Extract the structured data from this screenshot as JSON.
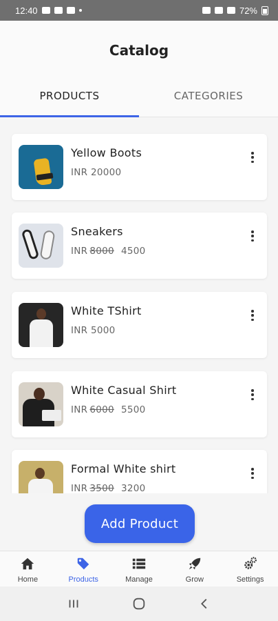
{
  "status_bar": {
    "time": "12:40",
    "battery": "72%"
  },
  "header": {
    "title": "Catalog"
  },
  "tabs": [
    {
      "label": "PRODUCTS",
      "active": true
    },
    {
      "label": "CATEGORIES",
      "active": false
    }
  ],
  "products": [
    {
      "name": "Yellow Boots",
      "currency": "INR",
      "price": "20000",
      "old_price": "",
      "image": "yellow-boots-photo"
    },
    {
      "name": "Sneakers",
      "currency": "INR",
      "price": "4500",
      "old_price": "8000",
      "image": "sneakers-photo"
    },
    {
      "name": "White TShirt",
      "currency": "INR",
      "price": "5000",
      "old_price": "",
      "image": "white-tshirt-photo"
    },
    {
      "name": "White Casual Shirt",
      "currency": "INR",
      "price": "5500",
      "old_price": "6000",
      "image": "white-casual-shirt-photo"
    },
    {
      "name": "Formal White shirt",
      "currency": "INR",
      "price": "3200",
      "old_price": "3500",
      "image": "formal-white-shirt-photo"
    }
  ],
  "add_button": {
    "label": "Add Product"
  },
  "bottom_nav": [
    {
      "label": "Home",
      "icon": "home-icon",
      "active": false
    },
    {
      "label": "Products",
      "icon": "tag-icon",
      "active": true
    },
    {
      "label": "Manage",
      "icon": "list-icon",
      "active": false
    },
    {
      "label": "Grow",
      "icon": "rocket-icon",
      "active": false
    },
    {
      "label": "Settings",
      "icon": "gears-icon",
      "active": false
    }
  ],
  "colors": {
    "accent": "#3d64e6",
    "background": "#f5f5f5"
  }
}
